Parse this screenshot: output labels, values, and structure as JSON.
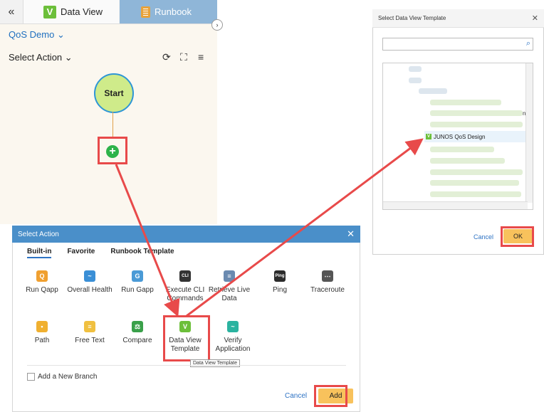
{
  "tabs": {
    "back_icon": "double-chevron-left-icon",
    "data_view": "Data View",
    "data_view_logo": "V",
    "runbook": "Runbook"
  },
  "runbook": {
    "title": "QoS Demo",
    "select_action": "Select Action",
    "start_node": "Start"
  },
  "select_action_dialog": {
    "title": "Select Action",
    "tabs": [
      "Built-in",
      "Favorite",
      "Runbook Template"
    ],
    "actions_row1": [
      {
        "label": "Run Qapp",
        "icon": "qapp-icon",
        "color": "#f0a030",
        "glyph": "Q"
      },
      {
        "label": "Overall Health",
        "icon": "health-icon",
        "color": "#3a8fd6",
        "glyph": "~"
      },
      {
        "label": "Run Gapp",
        "icon": "gapp-icon",
        "color": "#4a9ad6",
        "glyph": "G"
      },
      {
        "label": "Execute CLI Commands",
        "icon": "cli-icon",
        "color": "#333333",
        "glyph": "CLI"
      },
      {
        "label": "Retrieve Live Data",
        "icon": "retrieve-icon",
        "color": "#6a8ab0",
        "glyph": "≡"
      },
      {
        "label": "Ping",
        "icon": "ping-icon",
        "color": "#2b2b2b",
        "glyph": "Ping"
      },
      {
        "label": "Traceroute",
        "icon": "traceroute-icon",
        "color": "#555555",
        "glyph": "⋯"
      }
    ],
    "actions_row2": [
      {
        "label": "Path",
        "icon": "path-icon",
        "color": "#f0b030",
        "glyph": "•"
      },
      {
        "label": "Free Text",
        "icon": "freetext-icon",
        "color": "#f0c040",
        "glyph": "≡"
      },
      {
        "label": "Compare",
        "icon": "compare-icon",
        "color": "#3aa04a",
        "glyph": "⚖"
      },
      {
        "label": "Data View Template",
        "icon": "dataview-icon",
        "color": "#6cbf3a",
        "glyph": "V"
      },
      {
        "label": "Verify Application",
        "icon": "verify-icon",
        "color": "#2bb3a0",
        "glyph": "~"
      }
    ],
    "tooltip": "Data View Template",
    "add_branch": "Add a New Branch",
    "cancel": "Cancel",
    "add": "Add"
  },
  "template_dialog": {
    "title": "Select Data View Template",
    "search_placeholder": "",
    "partial_text": "n",
    "selected_item": "JUNOS QoS Design",
    "cancel": "Cancel",
    "ok": "OK"
  }
}
